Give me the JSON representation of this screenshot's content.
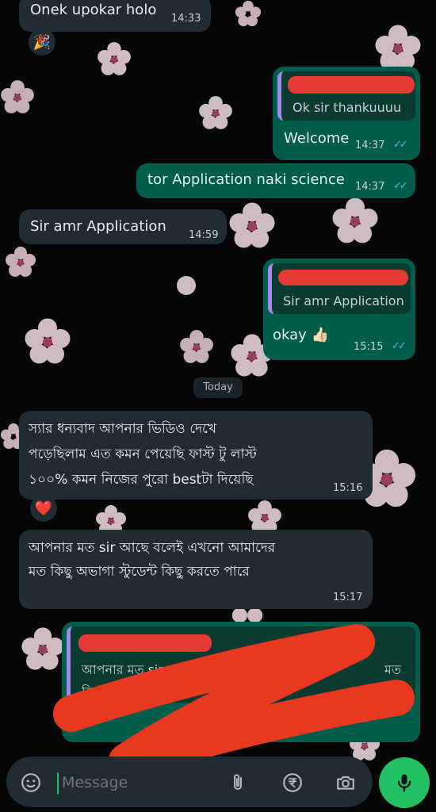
{
  "messages": [
    {
      "text": "Onek upokar holo",
      "time": "14:33",
      "reaction": "🎉"
    },
    {
      "quote": "Ok sir thankuuuu",
      "text": "Welcome",
      "time": "14:37"
    },
    {
      "text": "tor Application naki science",
      "time": "14:37"
    },
    {
      "text": "Sir amr Application",
      "time": "14:59"
    },
    {
      "quote": "Sir amr Application",
      "text": "okay 👍🏻",
      "time": "15:15"
    },
    {
      "lines": [
        "স্যার ধন্যবাদ  আপনার ভিডিও দেখে",
        "পড়েছিলাম এত কমন পেয়েছি ফাস্ট টু লাস্ট",
        "১০০% কমন নিজের পুরো bestটা দিয়েছি"
      ],
      "time": "15:16",
      "reaction": "❤️"
    },
    {
      "lines": [
        "আপনার মত sir  আছে বলেই এখনো আমাদের",
        "মত কিছু অভাগা স্টুডেন্ট কিছু করতে পারে"
      ],
      "time": "15:17"
    },
    {
      "quote_lines": [
        "আপনার মত sir  আছে",
        "মত",
        "কিছু অভাগা"
      ]
    }
  ],
  "date_divider": "Today",
  "input": {
    "placeholder": "Message"
  },
  "icons": {
    "emoji": "emoji-icon",
    "attach": "paperclip-icon",
    "payment": "rupee-icon",
    "camera": "camera-icon",
    "mic": "mic-icon"
  },
  "colors": {
    "incoming": "#202c33",
    "outgoing": "#005c4b",
    "tick": "#53bdeb",
    "mic": "#21c063",
    "redaction": "#e53935"
  }
}
